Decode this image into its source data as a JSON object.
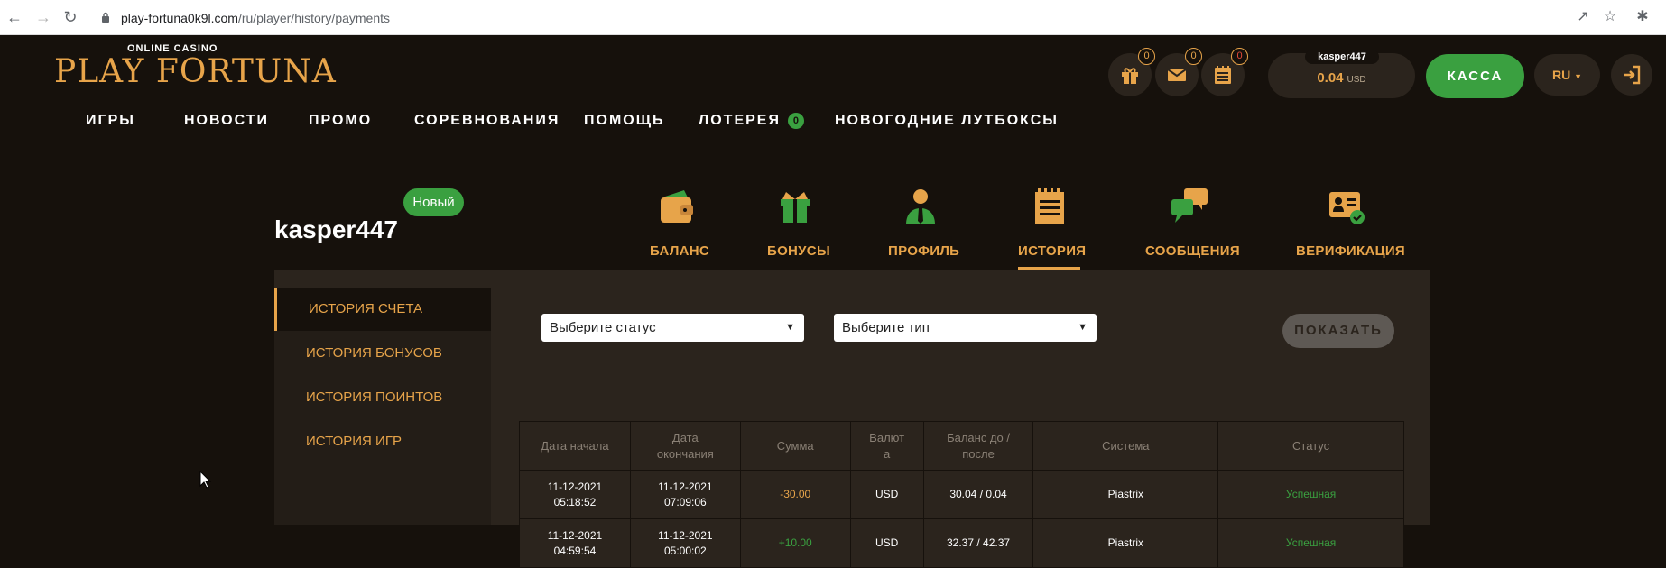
{
  "browser": {
    "url_domain": "play-fortuna0k9l.com",
    "url_path": "/ru/player/history/payments"
  },
  "logo": {
    "small": "ONLINE CASINO",
    "main": "PLAY FORTUNA"
  },
  "nav": {
    "items": [
      "ИГРЫ",
      "НОВОСТИ",
      "ПРОМО",
      "СОРЕВНОВАНИЯ",
      "ПОМОЩЬ",
      "ЛОТЕРЕЯ",
      "НОВОГОДНИЕ ЛУТБОКСЫ"
    ],
    "lottery_count": "0"
  },
  "header": {
    "gift_count": "0",
    "mail_count": "0",
    "notes_count": "0",
    "username": "kasper447",
    "balance": "0.04",
    "currency": "USD",
    "kassa_label": "КАССА",
    "lang": "RU"
  },
  "profile": {
    "username": "kasper447",
    "badge": "Новый",
    "tabs": [
      "БАЛАНС",
      "БОНУСЫ",
      "ПРОФИЛЬ",
      "ИСТОРИЯ",
      "СООБЩЕНИЯ",
      "ВЕРИФИКАЦИЯ"
    ],
    "active_tab": "ИСТОРИЯ"
  },
  "side_menu": [
    "ИСТОРИЯ СЧЕТА",
    "ИСТОРИЯ БОНУСОВ",
    "ИСТОРИЯ ПОИНТОВ",
    "ИСТОРИЯ ИГР"
  ],
  "filters": {
    "status_placeholder": "Выберите статус",
    "type_placeholder": "Выберите тип",
    "show_label": "ПОКАЗАТЬ"
  },
  "table": {
    "headers": [
      "Дата начала",
      "Дата окончания",
      "Сумма",
      "Валюта",
      "Баланс до / после",
      "Система",
      "Статус"
    ],
    "header_lines": [
      [
        "Дата начала"
      ],
      [
        "Дата",
        "окончания"
      ],
      [
        "Сумма"
      ],
      [
        "Валют",
        "а"
      ],
      [
        "Баланс до /",
        "после"
      ],
      [
        "Система"
      ],
      [
        "Статус"
      ]
    ],
    "rows": [
      {
        "start_date": "11-12-2021",
        "start_time": "05:18:52",
        "end_date": "11-12-2021",
        "end_time": "07:09:06",
        "amount": "-30.00",
        "currency": "USD",
        "balance": "30.04 / 0.04",
        "system": "Piastrix",
        "status": "Успешная"
      },
      {
        "start_date": "11-12-2021",
        "start_time": "04:59:54",
        "end_date": "11-12-2021",
        "end_time": "05:00:02",
        "amount": "+10.00",
        "currency": "USD",
        "balance": "32.37 / 42.37",
        "system": "Piastrix",
        "status": "Успешная"
      }
    ]
  },
  "colors": {
    "accent": "#e7a44a",
    "green": "#3aa040",
    "background": "#16110c",
    "panel": "#2b241d"
  }
}
